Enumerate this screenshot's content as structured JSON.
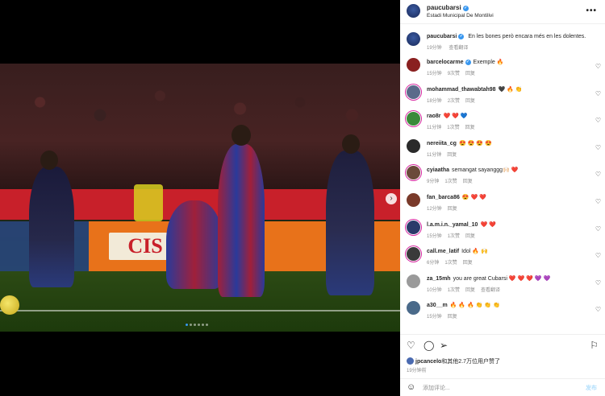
{
  "header": {
    "username": "paucubarsi",
    "location": "Estadi Municipal De Montilivi",
    "more_icon": "ellipsis-icon"
  },
  "caption": {
    "username": "paucubarsi",
    "text": "En les bones però encara més en les dolentes.",
    "time": "19分钟",
    "translate": "查看翻译"
  },
  "comments": [
    {
      "username": "barcelocarme",
      "verified": true,
      "text": "Exemple 🔥",
      "time": "15分钟",
      "likes": "9次赞",
      "reply": "回复",
      "ring": false,
      "color": "#8a2020"
    },
    {
      "username": "mohammad_thawabtah98",
      "verified": false,
      "text": "🖤 🔥 👏",
      "time": "18分钟",
      "likes": "2次赞",
      "reply": "回复",
      "ring": true,
      "color": "#5a6a8a"
    },
    {
      "username": "rao8r",
      "verified": false,
      "text": "❤️ ❤️ 💙",
      "time": "11分钟",
      "likes": "1次赞",
      "reply": "回复",
      "ring": true,
      "color": "#3a8a3a"
    },
    {
      "username": "nereiita_cg",
      "verified": false,
      "text": "😍 😍 😍 😍",
      "time": "11分钟",
      "likes": "",
      "reply": "回复",
      "ring": false,
      "color": "#2a2a2a"
    },
    {
      "username": "cyiaatha",
      "verified": false,
      "text": "semangat sayanggg🙌🏻 ❤️",
      "time": "9分钟",
      "likes": "1次赞",
      "reply": "回复",
      "ring": true,
      "color": "#6a4a3a"
    },
    {
      "username": "fan_barca86",
      "verified": false,
      "text": "😍 ❤️ ❤️",
      "time": "12分钟",
      "likes": "",
      "reply": "回复",
      "ring": false,
      "color": "#7a3a2a"
    },
    {
      "username": "l.a.m.i.n._yamal_10",
      "verified": false,
      "text": "❤️ ❤️",
      "time": "15分钟",
      "likes": "1次赞",
      "reply": "回复",
      "ring": true,
      "color": "#2a3a6a"
    },
    {
      "username": "call.me_latif",
      "verified": false,
      "text": "Idol 🔥 🙌",
      "time": "6分钟",
      "likes": "1次赞",
      "reply": "回复",
      "ring": true,
      "color": "#3a3a3a"
    },
    {
      "username": "za_15mh",
      "verified": false,
      "text": "you are great Cubarsi ❤️ ❤️ ❤️ 💜 💜",
      "time": "10分钟",
      "likes": "1次赞",
      "reply": "回复",
      "translate": "查看翻译",
      "ring": false,
      "color": "#9a9a9a"
    },
    {
      "username": "a30__m",
      "verified": false,
      "text": "🔥 🔥 🔥 👏 👏 👏",
      "time": "15分钟",
      "likes": "",
      "reply": "回复",
      "ring": false,
      "color": "#4a6a8a"
    }
  ],
  "liked_by": {
    "user": "jpcancelo",
    "rest": "和其他2.7万位用户",
    "suffix": "赞了"
  },
  "post_time": "19分钟前",
  "add_comment": {
    "placeholder": "添加评论...",
    "post_label": "发布"
  },
  "colors": {
    "accent": "#3897f0",
    "text": "#262626",
    "muted": "#8e8e8e"
  }
}
